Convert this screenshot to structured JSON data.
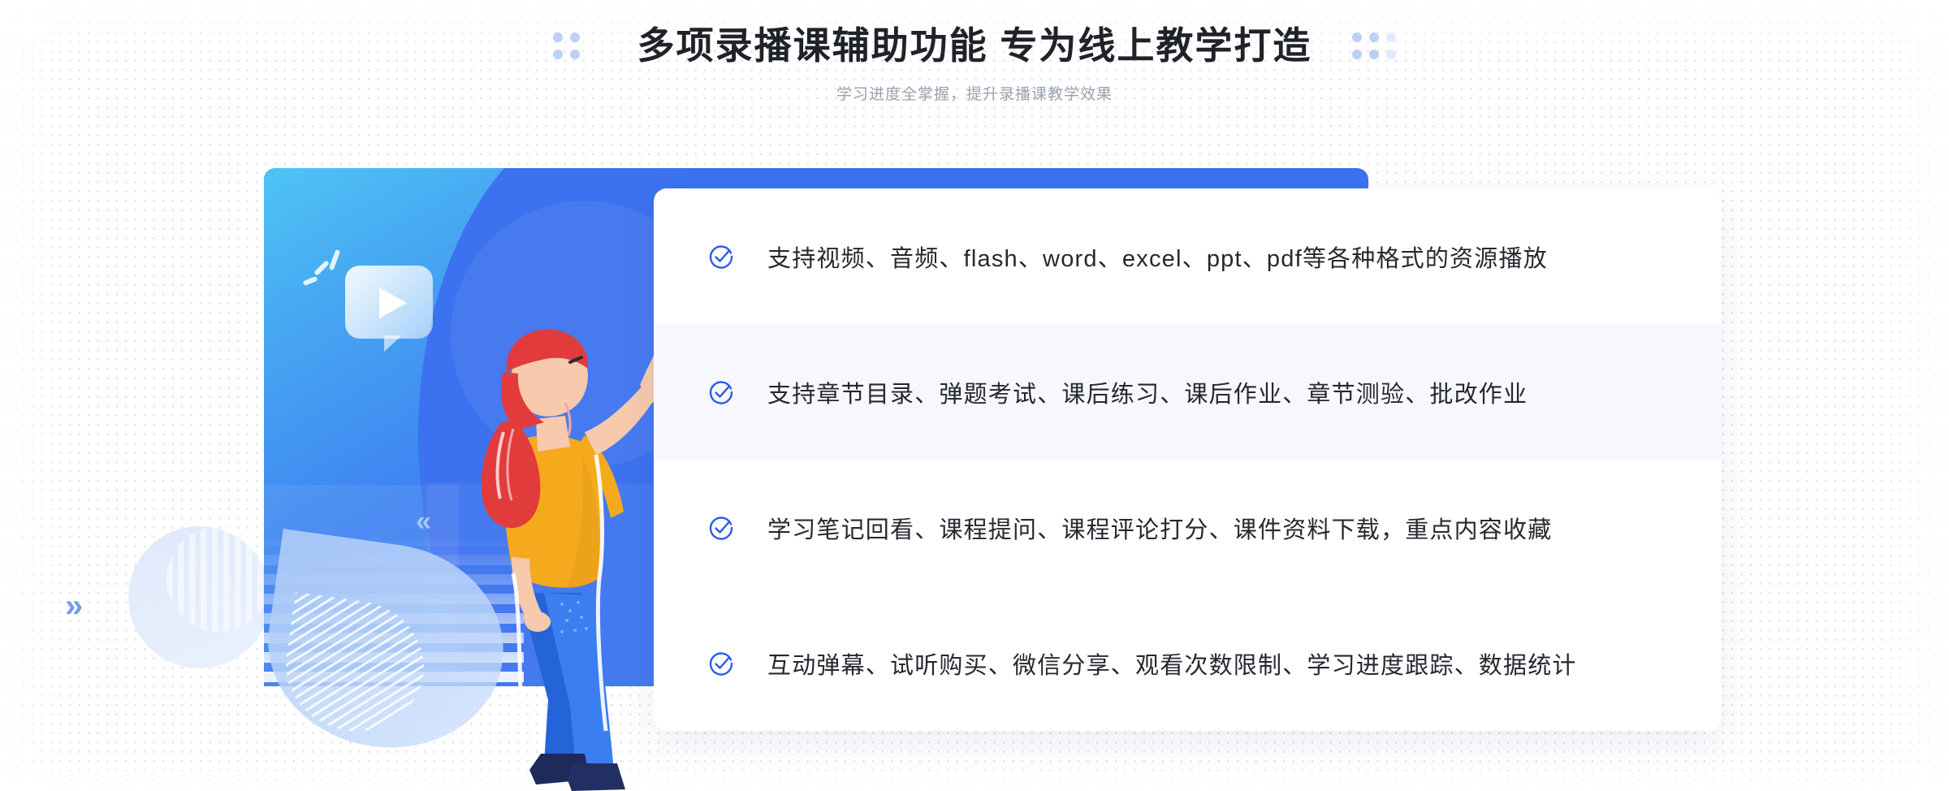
{
  "header": {
    "title": "多项录播课辅助功能 专为线上教学打造",
    "subtitle": "学习进度全掌握，提升录播课教学效果",
    "dots_left_icon": "dot-grid-decoration",
    "dots_right_icon": "dot-grid-decoration"
  },
  "illustration": {
    "play_bubble_icon": "play-button-speech-bubble",
    "chevron_left_icon": "double-chevron-right",
    "chevron_panel_icon": "double-chevron-left",
    "character_alt": "woman-pointing-up-illustration"
  },
  "features": [
    {
      "icon": "check-circle-icon",
      "text": "支持视频、音频、flash、word、excel、ppt、pdf等各种格式的资源播放",
      "highlighted": false
    },
    {
      "icon": "check-circle-icon",
      "text": "支持章节目录、弹题考试、课后练习、课后作业、章节测验、批改作业",
      "highlighted": true
    },
    {
      "icon": "check-circle-icon",
      "text": "学习笔记回看、课程提问、课程评论打分、课件资料下载，重点内容收藏",
      "highlighted": false
    },
    {
      "icon": "check-circle-icon",
      "text": "互动弹幕、试听购买、微信分享、观看次数限制、学习进度跟踪、数据统计",
      "highlighted": false
    }
  ],
  "colors": {
    "brand_blue": "#3b72f0",
    "title_text": "#1f2229",
    "subtitle_text": "#9aa1ad",
    "feature_text": "#25282f",
    "alt_row_bg": "#f6f8fd",
    "accent_cyan": "#4ec4f5",
    "shirt_yellow": "#f5aa1e",
    "hair_red": "#e23b3b",
    "jeans_blue": "#2f6fe0",
    "shoe_navy": "#1e2a5a",
    "skin": "#f7c9ad"
  }
}
